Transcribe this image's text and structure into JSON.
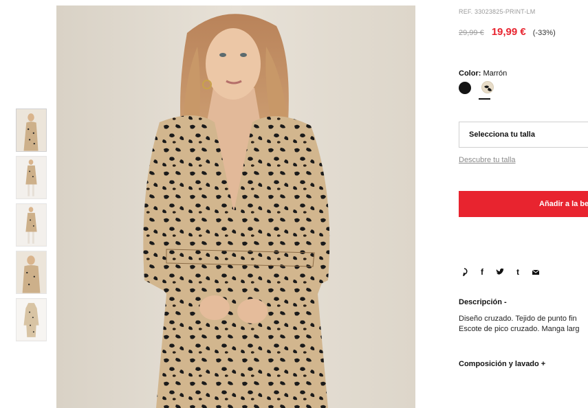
{
  "product": {
    "reference": "REF. 33023825-PRINT-LM",
    "price_old": "29,99 €",
    "price_new": "19,99 €",
    "discount": "(-33%)",
    "color_label": "Color:",
    "color_value": "Marrón",
    "swatches": [
      {
        "name": "black",
        "color": "#141414"
      },
      {
        "name": "print",
        "color": "#e7dcc8",
        "selected": true
      }
    ],
    "size_select_label": "Selecciona tu talla",
    "size_guide_link": "Descubre tu talla",
    "add_button": "Añadir a la be",
    "description_title": "Descripción -",
    "description_lines": [
      "Diseño cruzado. Tejido de punto fin",
      "Escote de pico cruzado. Manga larg"
    ],
    "composition_title": "Composición y lavado +"
  },
  "social": {
    "icons": [
      "pinterest-icon",
      "facebook-icon",
      "twitter-icon",
      "tumblr-icon",
      "email-icon"
    ],
    "labels": [
      "P",
      "f",
      "",
      "t",
      ""
    ]
  },
  "gallery": {
    "thumbnail_count": 5,
    "selected_index": 0
  },
  "colors": {
    "accent": "#e8242f",
    "muted_text": "#9a9a9a",
    "border": "#cfcfcf"
  }
}
